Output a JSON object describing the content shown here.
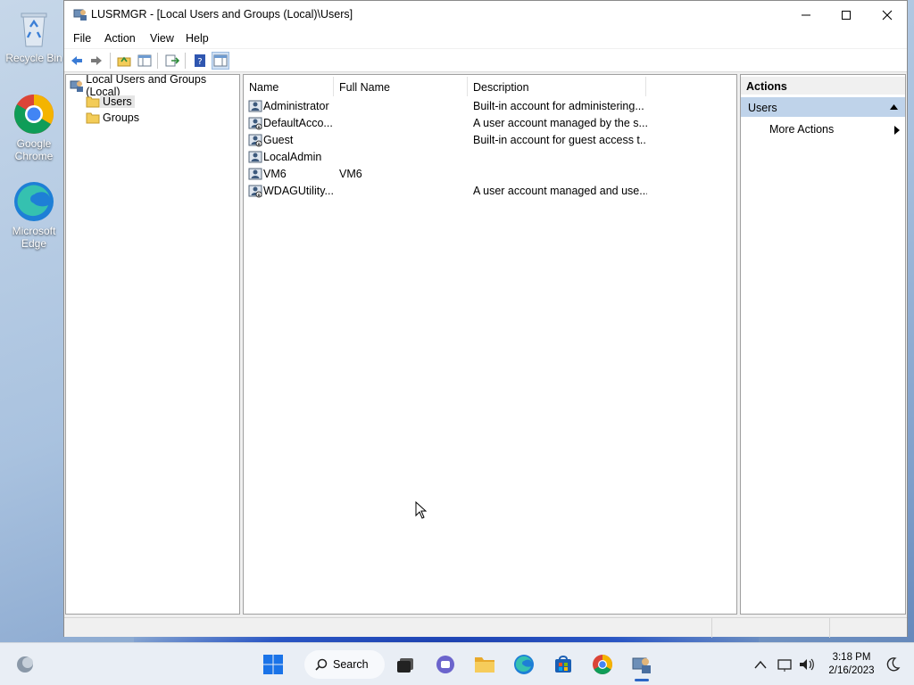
{
  "desktop": {
    "icons": [
      {
        "label": "Recycle Bin"
      },
      {
        "label": "Google Chrome"
      },
      {
        "label": "Microsoft Edge"
      }
    ]
  },
  "window": {
    "title": "LUSRMGR - [Local Users and Groups (Local)\\Users]",
    "menu": [
      "File",
      "Action",
      "View",
      "Help"
    ]
  },
  "tree": {
    "root": "Local Users and Groups (Local)",
    "children": [
      {
        "label": "Users",
        "selected": true
      },
      {
        "label": "Groups",
        "selected": false
      }
    ]
  },
  "list": {
    "columns": [
      "Name",
      "Full Name",
      "Description"
    ],
    "rows": [
      {
        "name": "Administrator",
        "full_name": "",
        "description": "Built-in account for administering..."
      },
      {
        "name": "DefaultAcco...",
        "full_name": "",
        "description": "A user account managed by the s..."
      },
      {
        "name": "Guest",
        "full_name": "",
        "description": "Built-in account for guest access t..."
      },
      {
        "name": "LocalAdmin",
        "full_name": "",
        "description": ""
      },
      {
        "name": "VM6",
        "full_name": "VM6",
        "description": ""
      },
      {
        "name": "WDAGUtility...",
        "full_name": "",
        "description": "A user account managed and use..."
      }
    ]
  },
  "actions": {
    "header": "Actions",
    "section": "Users",
    "items": [
      "More Actions"
    ]
  },
  "taskbar": {
    "search_label": "Search",
    "time": "3:18 PM",
    "date": "2/16/2023"
  },
  "colors": {
    "accent": "#2b66c5",
    "selection": "#bfd3ea",
    "folder": "#f3cc58"
  }
}
